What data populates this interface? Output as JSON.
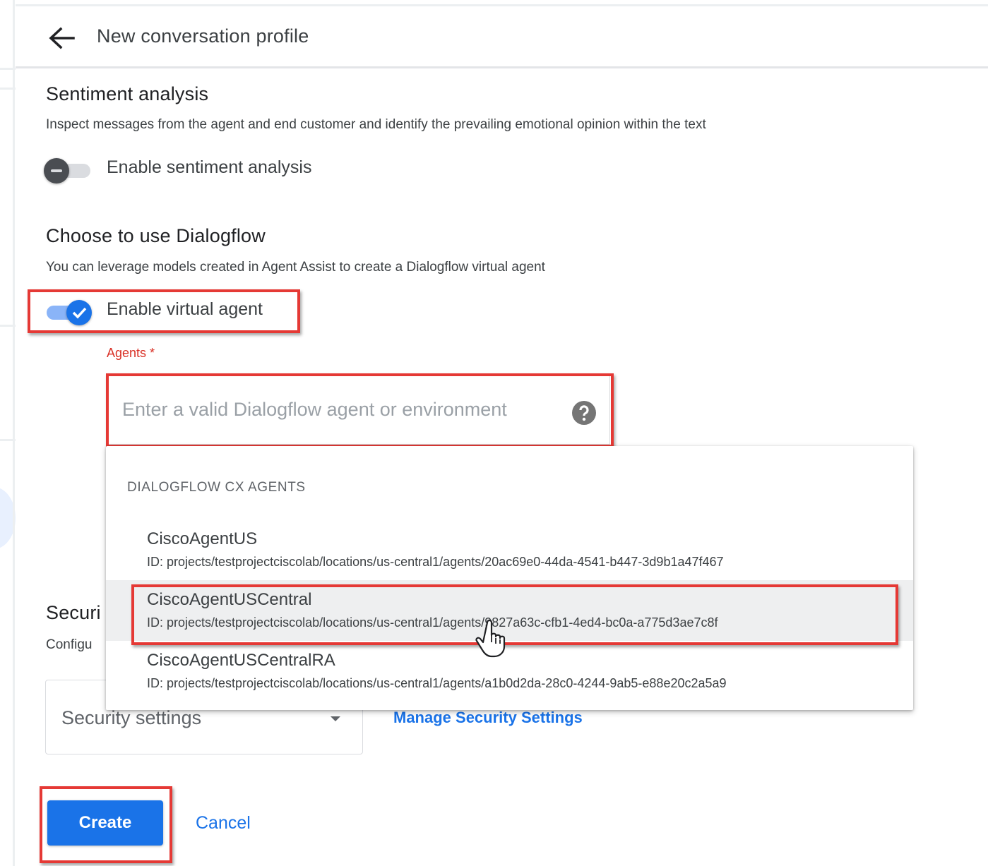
{
  "header": {
    "title": "New conversation profile",
    "back_icon": "arrow-back-icon"
  },
  "sentiment": {
    "title": "Sentiment analysis",
    "description": "Inspect messages from the agent and end customer and identify the prevailing emotional opinion within the text",
    "toggle_label": "Enable sentiment analysis",
    "enabled": false
  },
  "dialogflow": {
    "title": "Choose to use Dialogflow",
    "description": "You can leverage models created in Agent Assist to create a Dialogflow virtual agent",
    "toggle_label": "Enable virtual agent",
    "enabled": true,
    "agents_label": "Agents *",
    "agents_placeholder": "Enter a valid Dialogflow agent or environment",
    "help_icon": "help-icon"
  },
  "agent_menu": {
    "header": "DIALOGFLOW CX AGENTS",
    "items": [
      {
        "name": "CiscoAgentUS",
        "id": "ID: projects/testprojectciscolab/locations/us-central1/agents/20ac69e0-44da-4541-b447-3d9b1a47f467"
      },
      {
        "name": "CiscoAgentUSCentral",
        "id": "ID: projects/testprojectciscolab/locations/us-central1/agents/9827a63c-cfb1-4ed4-bc0a-a775d3ae7c8f"
      },
      {
        "name": "CiscoAgentUSCentralRA",
        "id": "ID: projects/testprojectciscolab/locations/us-central1/agents/a1b0d2da-28c0-4244-9ab5-e88e20c2a5a9"
      }
    ],
    "hovered_index": 1
  },
  "security": {
    "title_partial": "Securi",
    "description_partial": "Configu",
    "select_value": "Security settings",
    "manage_link": "Manage Security Settings"
  },
  "actions": {
    "create_label": "Create",
    "cancel_label": "Cancel"
  },
  "colors": {
    "primary": "#1a73e8",
    "error": "#d93025",
    "annotation": "#e53935"
  }
}
